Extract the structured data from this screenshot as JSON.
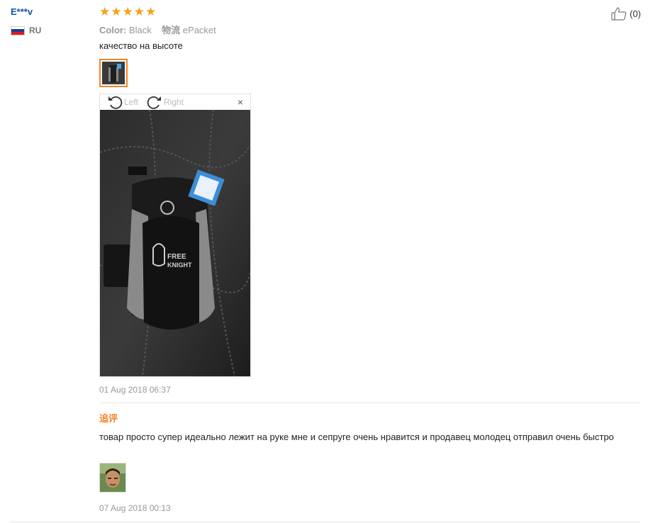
{
  "user": {
    "name": "E***v",
    "country": "RU"
  },
  "colors": {
    "star": "#f4a21b",
    "accent": "#f5832a",
    "username": "#0b5aa5"
  },
  "rating": {
    "stars": 5,
    "max": 5
  },
  "like": {
    "icon": "thumbs-up-icon",
    "count": "(0)"
  },
  "attributes": {
    "color_label": "Color:",
    "color_value": "Black",
    "shipping_label": "物流",
    "shipping_value": "ePacket"
  },
  "review_text": "качество на высоте",
  "image_viewer": {
    "rotate_left_label": "Left",
    "rotate_right_label": "Right",
    "close_icon": "×"
  },
  "review_date": "01 Aug 2018 06:37",
  "additional": {
    "label": "追评",
    "text": "товар просто супер идеально лежит на руке мне и сепруге очень нравится и продавец молодец отправил очень быстро",
    "date": "07 Aug 2018 00:13"
  }
}
